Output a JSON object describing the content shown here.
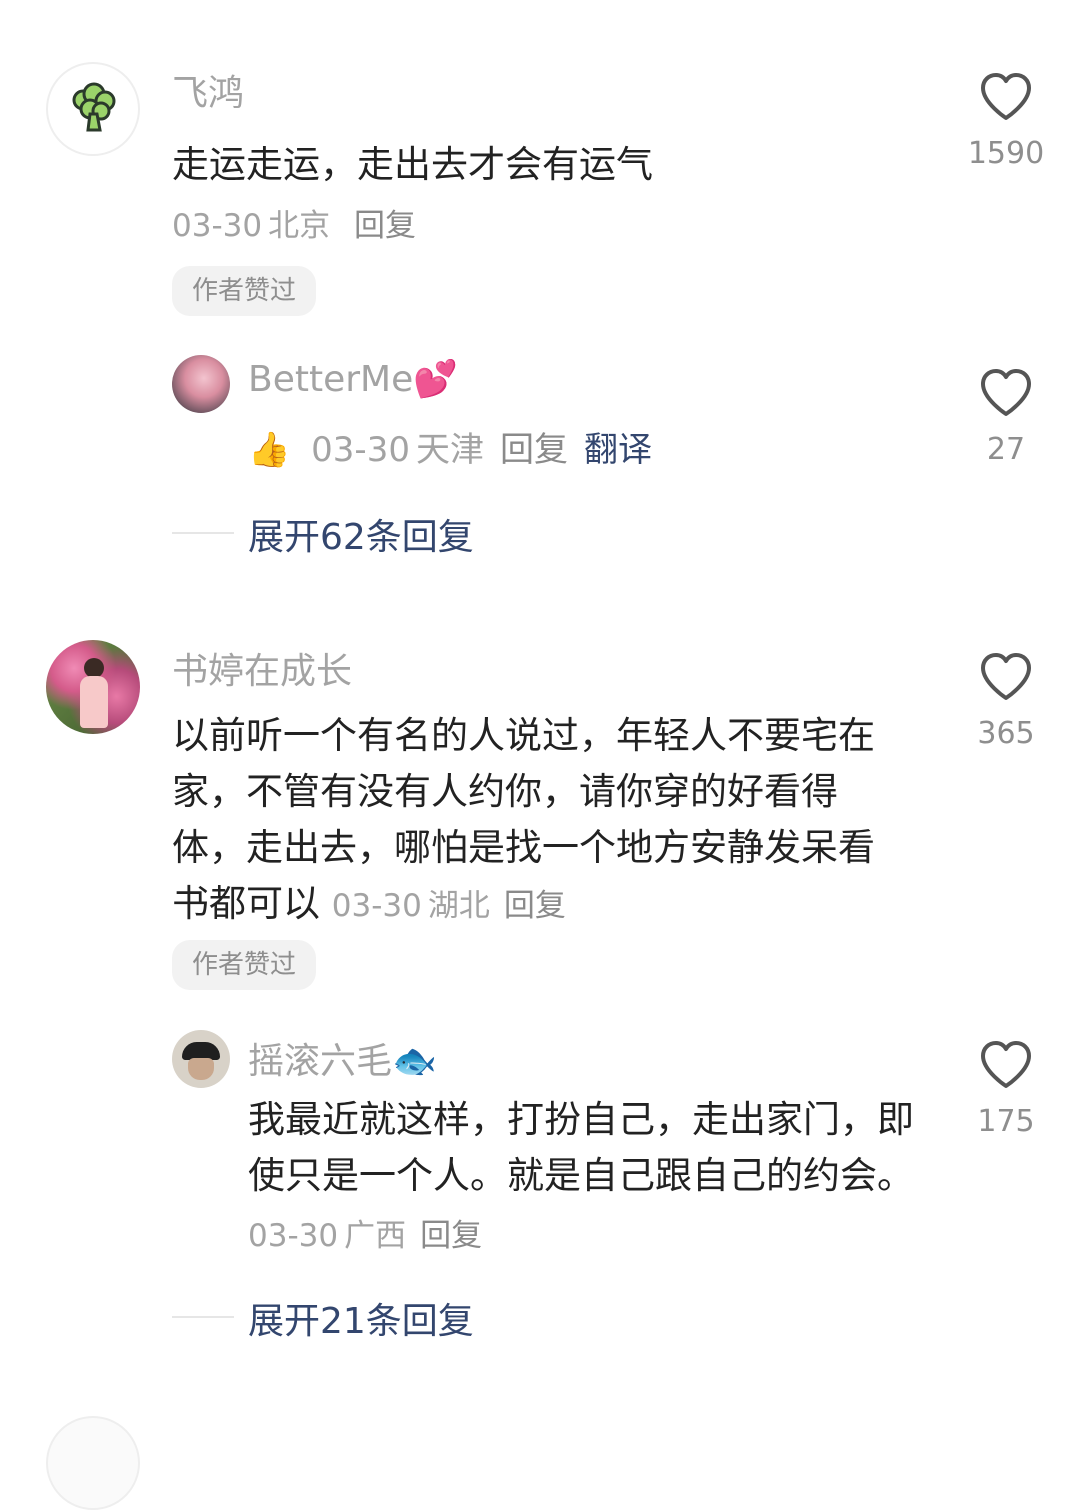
{
  "comments": [
    {
      "name": "飞鸿",
      "text": "走运走运，走出去才会有运气",
      "date": "03-30",
      "location": "北京",
      "reply_label": "回复",
      "badge": "作者赞过",
      "likes": "1590",
      "avatar_icon": "broccoli-icon",
      "sub_reply": {
        "name": "BetterMe",
        "name_emoji": "💕",
        "text_emoji": "👍",
        "date": "03-30",
        "location": "天津",
        "reply_label": "回复",
        "translate_label": "翻译",
        "likes": "27"
      },
      "expand_label": "展开62条回复"
    },
    {
      "name": "书婷在成长",
      "text": "以前听一个有名的人说过，年轻人不要宅在家，不管有没有人约你，请你穿的好看得体，走出去，哪怕是找一个地方安静发呆看书都可以",
      "date": "03-30",
      "location": "湖北",
      "reply_label": "回复",
      "badge": "作者赞过",
      "likes": "365",
      "sub_reply": {
        "name": "摇滚六毛",
        "name_emoji": "🐟",
        "text": "我最近就这样，打扮自己，走出家门，即使只是一个人。就是自己跟自己的约会。",
        "date": "03-30",
        "location": "广西",
        "reply_label": "回复",
        "likes": "175"
      },
      "expand_label": "展开21条回复"
    }
  ],
  "colors": {
    "name_gray": "#a3a3a3",
    "text_dark": "#222222",
    "link_blue": "#33466e",
    "badge_bg": "#f2f2f2"
  }
}
